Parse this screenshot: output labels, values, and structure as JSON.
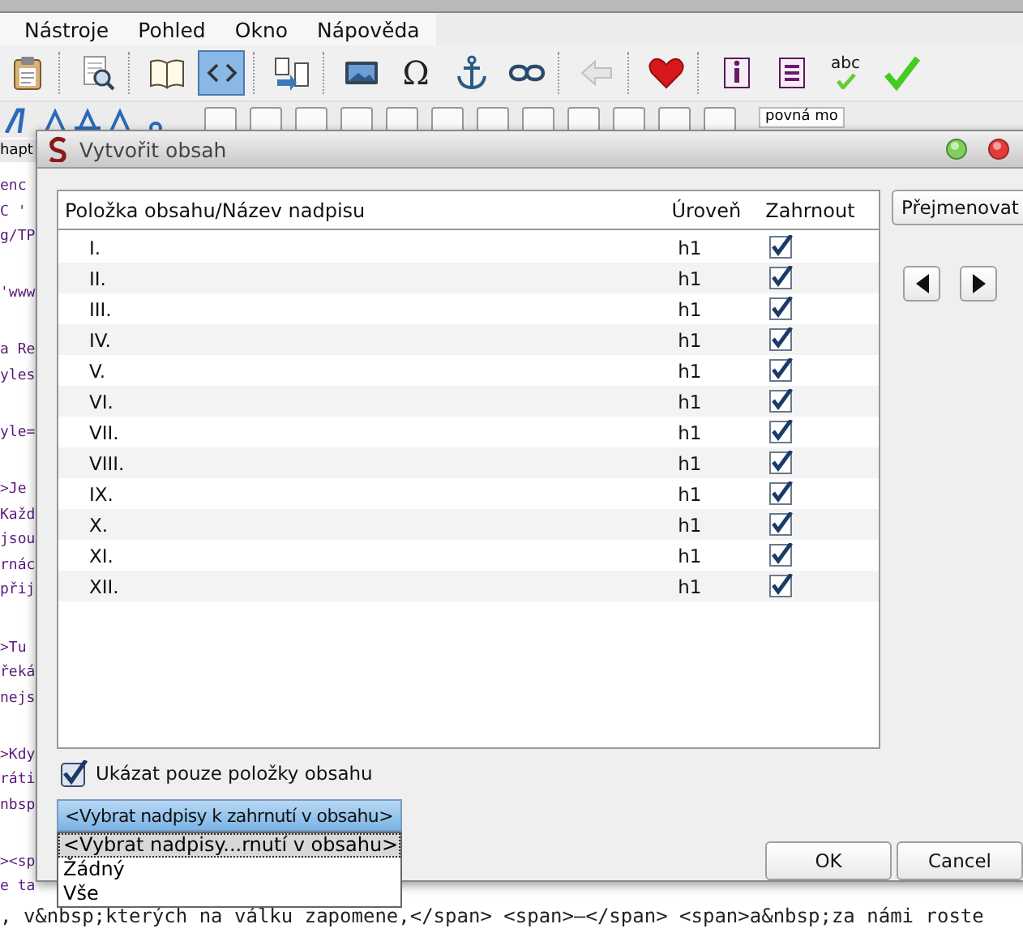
{
  "menu": [
    {
      "label": "Nástroje"
    },
    {
      "label": "Pohled"
    },
    {
      "label": "Okno"
    },
    {
      "label": "Nápověda"
    }
  ],
  "toolbar": {
    "source_view": {
      "selected": true
    },
    "back": {
      "disabled": true
    },
    "symbol": "Ω",
    "spell": "abc"
  },
  "format_select": {
    "value": "povná mo"
  },
  "editor_tab": "hapt",
  "code_blocks": [
    [
      "enc",
      "C '",
      "g/TP"
    ],
    [
      "'www"
    ],
    [
      "a Re",
      "yles"
    ],
    [
      "yle="
    ],
    [
      ">Je",
      "Každ",
      "jsou",
      "rnác",
      "přij"
    ],
    [
      ">Tu",
      "řeká",
      "nejs"
    ],
    [
      ">Kdy",
      "ráti",
      "nbsp"
    ],
    [
      "><sp",
      "e ta"
    ]
  ],
  "code_tail": ", v&nbsp;kterých na válku zapomene,</span> <span>–</span> <span>a&nbsp;za námi roste",
  "dialog": {
    "title": "Vytvořit obsah",
    "table": {
      "columns": [
        "Položka obsahu/Název nadpisu",
        "Úroveň",
        "Zahrnout"
      ],
      "rows": [
        {
          "name": "I.",
          "heading": "h1",
          "included": true
        },
        {
          "name": "II.",
          "heading": "h1",
          "included": true
        },
        {
          "name": "III.",
          "heading": "h1",
          "included": true
        },
        {
          "name": "IV.",
          "heading": "h1",
          "included": true
        },
        {
          "name": "V.",
          "heading": "h1",
          "included": true
        },
        {
          "name": "VI.",
          "heading": "h1",
          "included": true
        },
        {
          "name": "VII.",
          "heading": "h1",
          "included": true
        },
        {
          "name": "VIII.",
          "heading": "h1",
          "included": true
        },
        {
          "name": "IX.",
          "heading": "h1",
          "included": true
        },
        {
          "name": "X.",
          "heading": "h1",
          "included": true
        },
        {
          "name": "XI.",
          "heading": "h1",
          "included": true
        },
        {
          "name": "XII.",
          "heading": "h1",
          "included": true
        }
      ]
    },
    "rename_button": "Přejmenovat",
    "show_only": {
      "label": "Ukázat pouze položky obsahu",
      "checked": true
    },
    "heading_select": {
      "value": "<Vybrat nadpisy k zahrnutí v obsahu>",
      "open": true,
      "options": [
        {
          "label": "<Vybrat nadpisy...rnutí v obsahu>",
          "selected": true
        },
        {
          "label": "Žádný",
          "selected": false
        },
        {
          "label": "Vše",
          "selected": false
        }
      ]
    },
    "buttons": [
      "OK",
      "Cancel"
    ]
  }
}
